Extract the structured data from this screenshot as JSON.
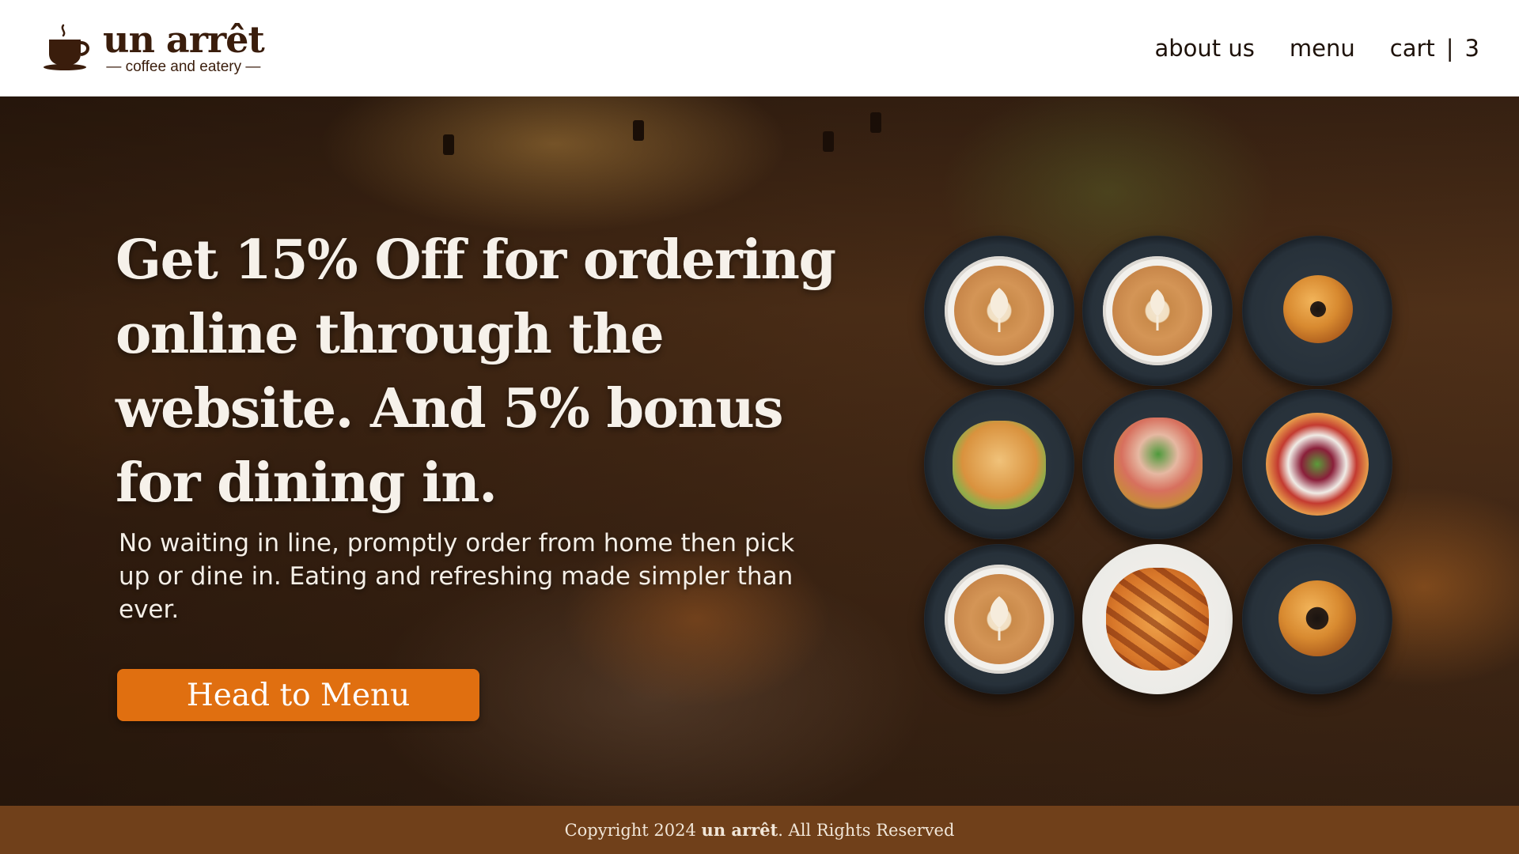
{
  "header": {
    "brand_name": "un arrêt",
    "brand_tagline": "— coffee and eatery —",
    "logo_icon": "coffee-cup-icon",
    "nav": {
      "about_label": "about us",
      "menu_label": "menu",
      "cart_label": "cart",
      "cart_separator": "|",
      "cart_count": "3"
    }
  },
  "hero": {
    "headline": "Get 15% Off for ordering online through the website. And 5% bonus for dining in.",
    "subtext": "No waiting in line, promptly order from home then pick up or dine in. Eating and refreshing made simpler than ever.",
    "cta_label": "Head to Menu"
  },
  "food_grid": {
    "items": [
      "latte",
      "latte",
      "bagel",
      "sandwich",
      "salad",
      "tart",
      "latte",
      "pastry",
      "sesame bun"
    ]
  },
  "footer": {
    "copyright_prefix": "Copyright 2024 ",
    "brand": "un arrêt",
    "copyright_suffix": ". All Rights Reserved"
  },
  "colors": {
    "brand_brown": "#3a1d0c",
    "cta_orange": "#e06f10",
    "footer_brown": "#70401a",
    "header_bg": "#ffffff"
  }
}
